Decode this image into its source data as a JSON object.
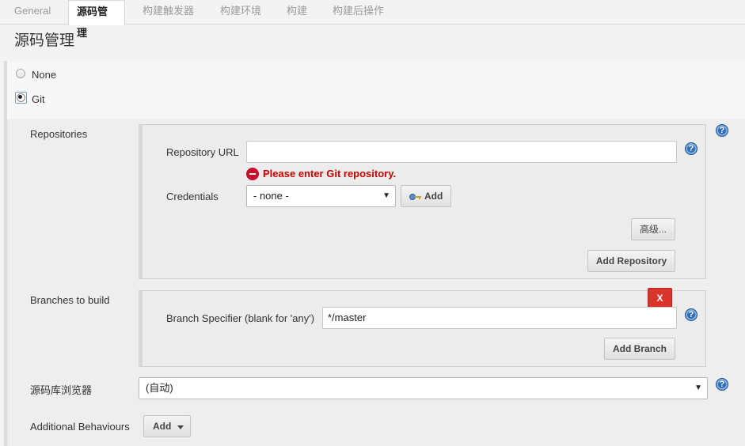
{
  "tabs": [
    {
      "label": "General"
    },
    {
      "label": "源码管理"
    },
    {
      "label": "构建触发器"
    },
    {
      "label": "构建环境"
    },
    {
      "label": "构建"
    },
    {
      "label": "构建后操作"
    }
  ],
  "section_title": "源码管理",
  "scm_options": {
    "none_label": "None",
    "git_label": "Git",
    "selected": "Git"
  },
  "repositories": {
    "label": "Repositories",
    "url_label": "Repository URL",
    "url_value": "",
    "error": "Please enter Git repository.",
    "credentials_label": "Credentials",
    "credentials_value": "- none -",
    "add_credentials_label": "Add",
    "advanced_label": "高级...",
    "add_repository_label": "Add Repository"
  },
  "branches": {
    "label": "Branches to build",
    "delete_label": "X",
    "specifier_label": "Branch Specifier (blank for 'any')",
    "specifier_value": "*/master",
    "add_branch_label": "Add Branch"
  },
  "repo_browser": {
    "label": "源码库浏览器",
    "value": "(自动)"
  },
  "additional_behaviours": {
    "label": "Additional Behaviours",
    "add_label": "Add"
  },
  "help_icon": "?",
  "colors": {
    "error": "#cc0000",
    "help": "#2d6db5",
    "delete": "#d9342b"
  }
}
